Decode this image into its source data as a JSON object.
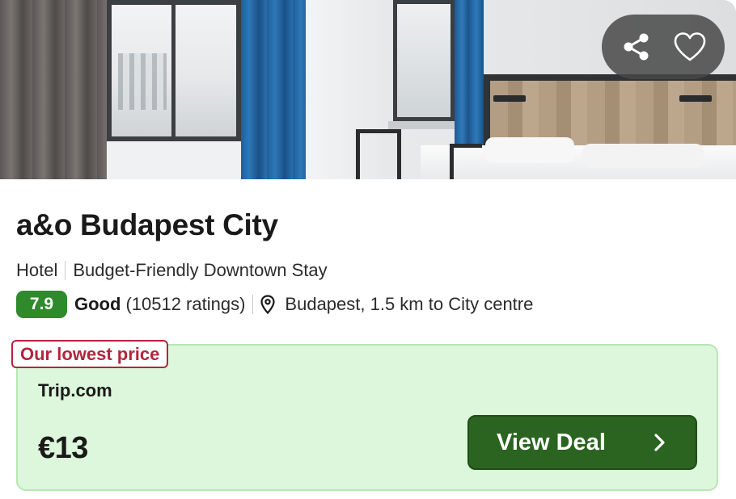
{
  "hotel": {
    "name": "a&o Budapest City",
    "type": "Hotel",
    "tagline": "Budget-Friendly Downtown Stay",
    "rating_score": "7.9",
    "rating_word": "Good",
    "rating_count": "(10512 ratings)",
    "location": "Budapest, 1.5 km to City centre"
  },
  "actions": {
    "share_icon": "share-icon",
    "favorite_icon": "heart-outline-icon"
  },
  "deal": {
    "badge": "Our lowest price",
    "provider": "Trip.com",
    "price": "€13",
    "cta_label": "View Deal",
    "cta_icon": "chevron-right-icon"
  },
  "colors": {
    "rating_badge": "#2f8a2b",
    "deal_background": "#dcf7db",
    "badge_accent": "#b3253c",
    "cta_background": "#2b6320"
  }
}
